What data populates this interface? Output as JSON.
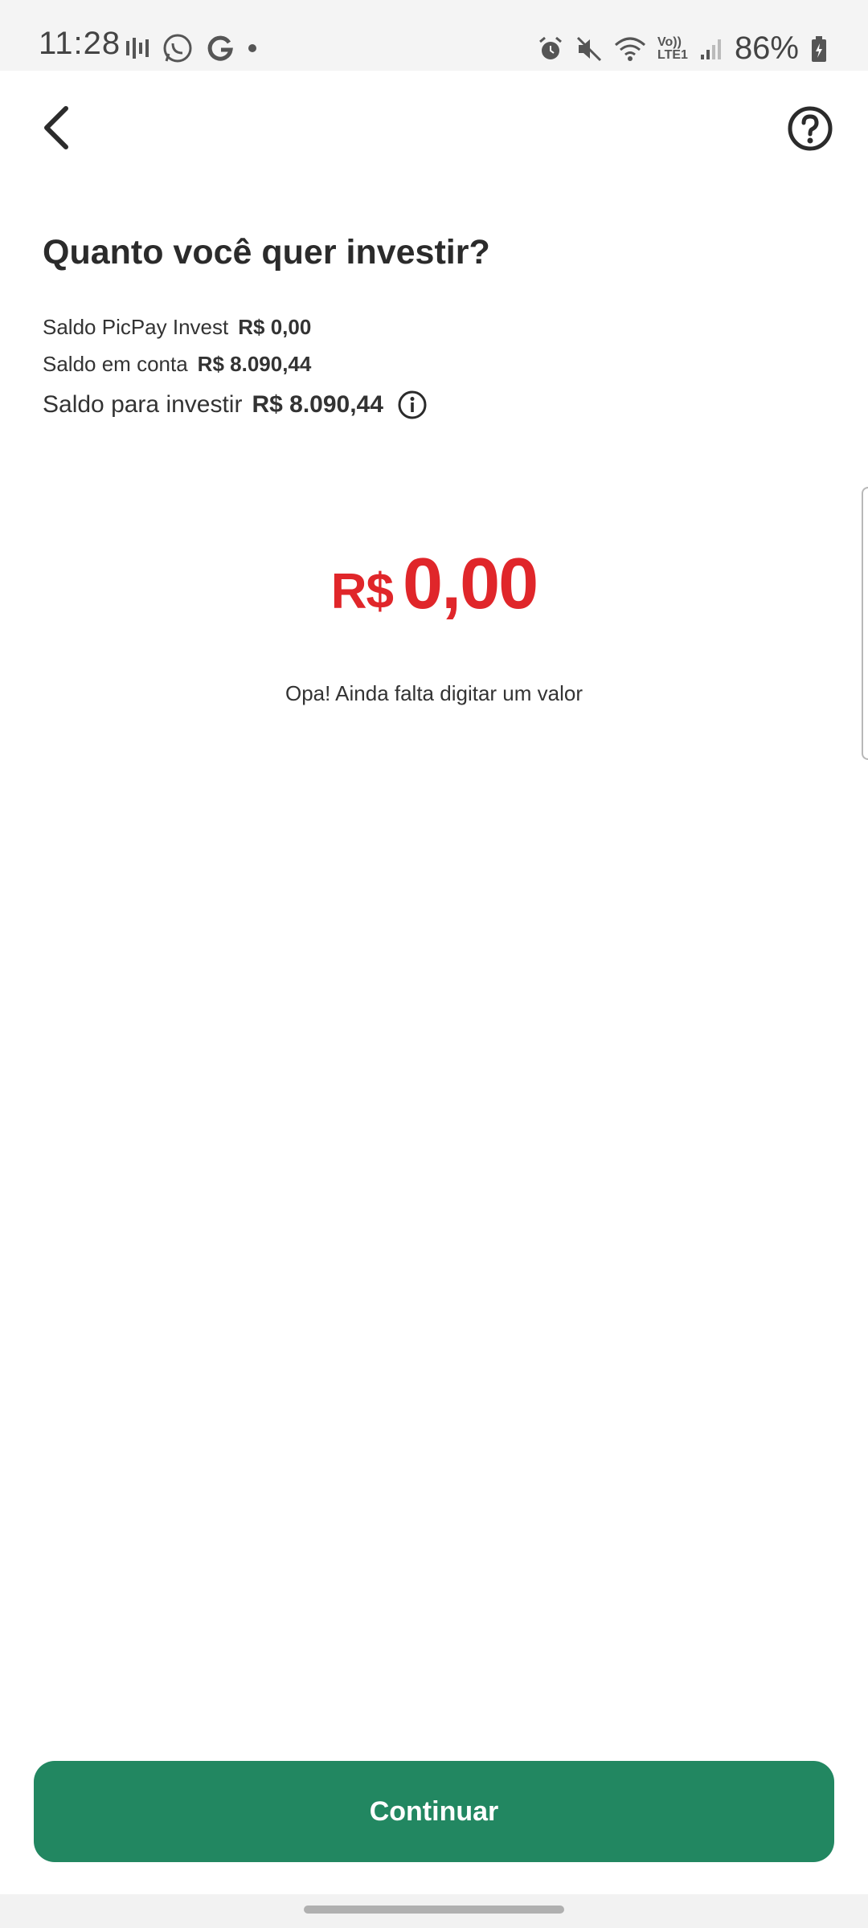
{
  "status_bar": {
    "time": "11:28",
    "battery": "86%",
    "left_icons": [
      "signal-bars-icon",
      "whatsapp-icon",
      "google-icon",
      "dot-icon"
    ],
    "right_icons": [
      "alarm-icon",
      "mute-icon",
      "wifi-icon",
      "volte-icon",
      "cell-signal-icon",
      "battery-icon"
    ],
    "volte_label": "Vo))",
    "lte_label": "LTE1"
  },
  "header": {
    "back_icon": "chevron-left-icon",
    "help_icon": "question-circle-icon"
  },
  "page": {
    "title": "Quanto você quer investir?"
  },
  "balances": [
    {
      "label": "Saldo PicPay Invest",
      "value": "R$ 0,00"
    },
    {
      "label": "Saldo em conta",
      "value": "R$ 8.090,44"
    },
    {
      "label": "Saldo para investir",
      "value": "R$ 8.090,44",
      "icon": "info-icon"
    }
  ],
  "amount": {
    "currency": "R$",
    "value": "0,00",
    "hint": "Opa! Ainda falta digitar um valor",
    "color": "#e0262a"
  },
  "footer": {
    "continue_label": "Continuar",
    "button_color": "#228761"
  }
}
